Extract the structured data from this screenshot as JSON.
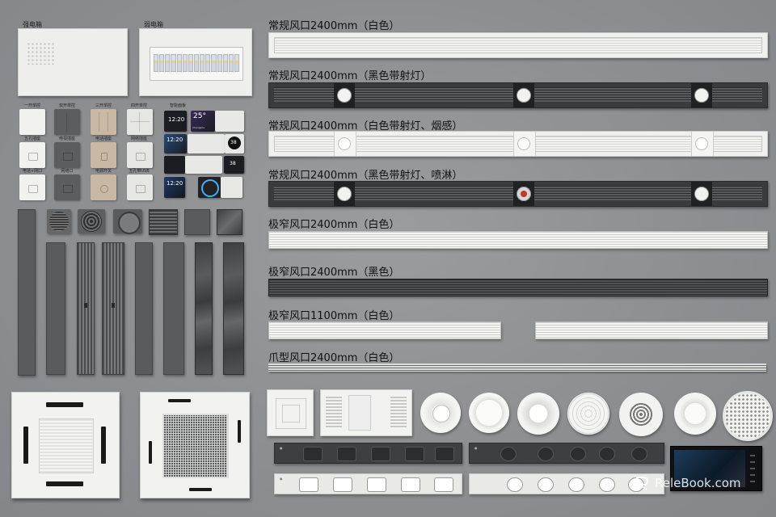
{
  "boxes": {
    "strong": "强电箱",
    "weak": "弱电箱"
  },
  "switches": {
    "row1": [
      "一开单控",
      "双开单控",
      "三开单控",
      "四开单控",
      "智能面板"
    ],
    "row2": [
      "五孔插座",
      "电视插座",
      "电话插座",
      "网络插座"
    ],
    "row3": [
      "电话+网口",
      "网络口",
      "电源开关",
      "五孔带USB"
    ]
  },
  "smart_panels": [
    {
      "time": "12:20"
    },
    {
      "temp": "25°",
      "sub": "Thunderstorm",
      "city": "Changsha"
    },
    {
      "temp": "38"
    },
    {
      "time": "12:20"
    },
    {
      "temp": "38"
    },
    {
      "time": "12:20"
    }
  ],
  "vents": [
    {
      "label": "常规风口2400mm（白色）"
    },
    {
      "label": "常规风口2400mm（黑色带射灯）"
    },
    {
      "label": "常规风口2400mm（白色带射灯、烟感）"
    },
    {
      "label": "常规风口2400mm（黑色带射灯、喷淋）"
    },
    {
      "label": "极窄风口2400mm（白色）"
    },
    {
      "label": "极窄风口2400mm（黑色）"
    },
    {
      "label": "极窄风口1100mm（白色）"
    },
    {
      "label": "爪型风口2400mm（白色）"
    }
  ],
  "watermark": "ReleBook.com",
  "colors": {
    "background": "#8f9092",
    "white_fixture": "#f0f0ee",
    "black_fixture": "#3a3b3d"
  }
}
